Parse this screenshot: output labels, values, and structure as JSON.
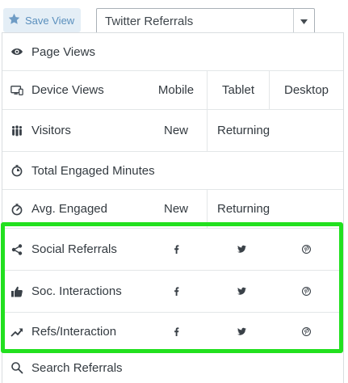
{
  "toolbar": {
    "save_label": "Save View",
    "view_select_value": "Twitter Referrals",
    "star_icon": "star-icon",
    "dropdown_icon": "caret-down-icon"
  },
  "colors": {
    "accent": "#5a8fbd",
    "highlight": "#22e01f",
    "text": "#333a40"
  },
  "metrics": {
    "page_views": {
      "label": "Page Views",
      "icon": "eye-icon"
    },
    "device_views": {
      "label": "Device Views",
      "icon": "devices-icon",
      "cols": [
        "Mobile",
        "Tablet",
        "Desktop"
      ]
    },
    "visitors": {
      "label": "Visitors",
      "icon": "people-icon",
      "cols": [
        "New",
        "Returning"
      ]
    },
    "total_engaged": {
      "label": "Total Engaged Minutes",
      "icon": "stopwatch-icon"
    },
    "avg_engaged": {
      "label": "Avg. Engaged",
      "icon": "timer-icon",
      "cols": [
        "New",
        "Returning"
      ]
    },
    "social_referrals": {
      "label": "Social Referrals",
      "icon": "share-icon",
      "cols": [
        "facebook-icon",
        "twitter-icon",
        "pinterest-icon"
      ]
    },
    "soc_interactions": {
      "label": "Soc. Interactions",
      "icon": "thumbs-up-icon",
      "cols": [
        "facebook-icon",
        "twitter-icon",
        "pinterest-icon"
      ]
    },
    "refs_interaction": {
      "label": "Refs/Interaction",
      "icon": "trend-up-icon",
      "cols": [
        "facebook-icon",
        "twitter-icon",
        "pinterest-icon"
      ]
    },
    "search_referrals": {
      "label": "Search Referrals"
    }
  }
}
